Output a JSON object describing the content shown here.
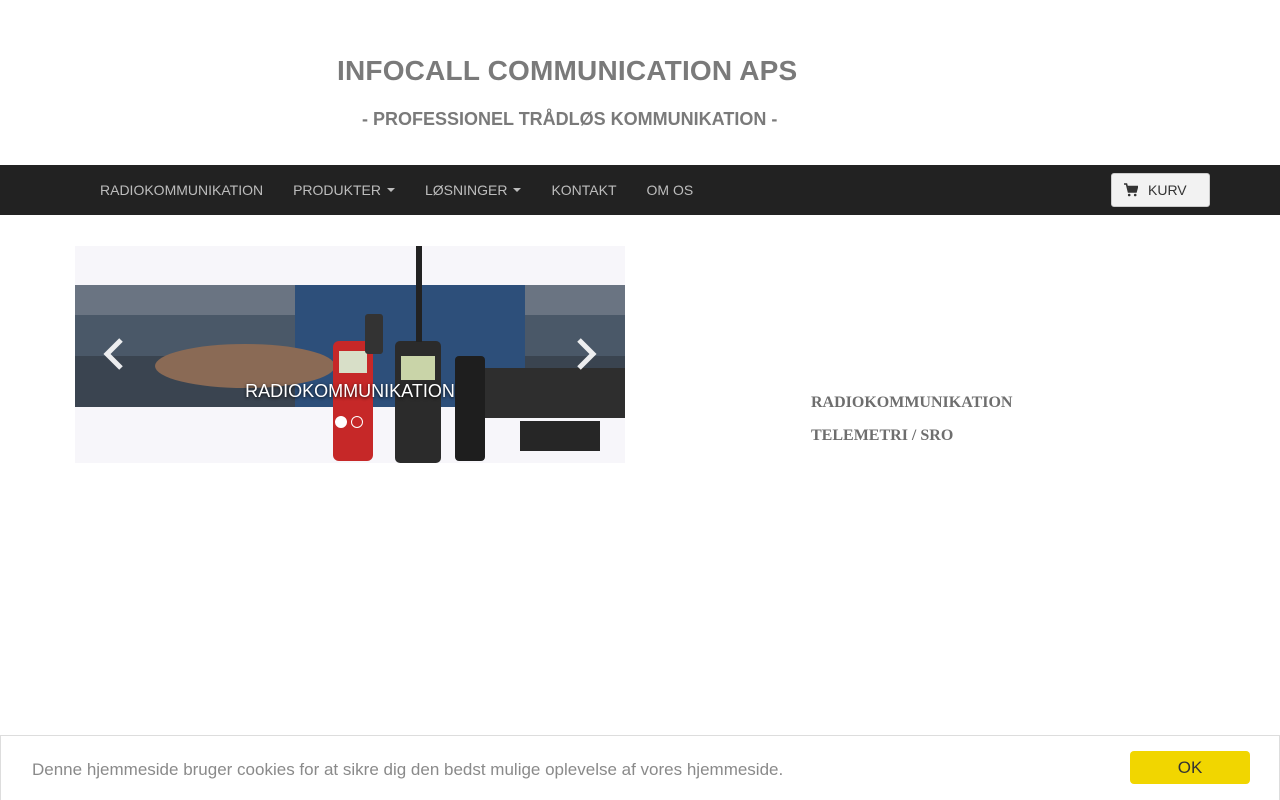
{
  "header": {
    "title": "INFOCALL COMMUNICATION APS",
    "tagline": "- PROFESSIONEL TRÅDLØS KOMMUNIKATION -"
  },
  "nav": {
    "items": [
      {
        "label": "RADIOKOMMUNIKATION",
        "dropdown": false
      },
      {
        "label": "PRODUKTER",
        "dropdown": true
      },
      {
        "label": "LØSNINGER",
        "dropdown": true
      },
      {
        "label": "KONTAKT",
        "dropdown": false
      },
      {
        "label": "OM OS",
        "dropdown": false
      }
    ],
    "cart_label": "KURV",
    "cart_icon": "shopping-cart-icon"
  },
  "carousel": {
    "caption": "RADIOKOMMUNIKATION",
    "slide_count": 2,
    "active_slide": 1,
    "prev_icon": "chevron-left-icon",
    "next_icon": "chevron-right-icon"
  },
  "side_links": [
    "RADIOKOMMUNIKATION",
    "TELEMETRI / SRO"
  ],
  "cookie": {
    "text": "Denne hjemmeside bruger cookies for at sikre dig den bedst mulige oplevelse af vores hjemmeside.",
    "button_label": "OK",
    "button_color": "#f1d600"
  },
  "colors": {
    "navbar": "#222222",
    "nav_text": "#bdbdbd",
    "title": "#7a7a7a"
  }
}
